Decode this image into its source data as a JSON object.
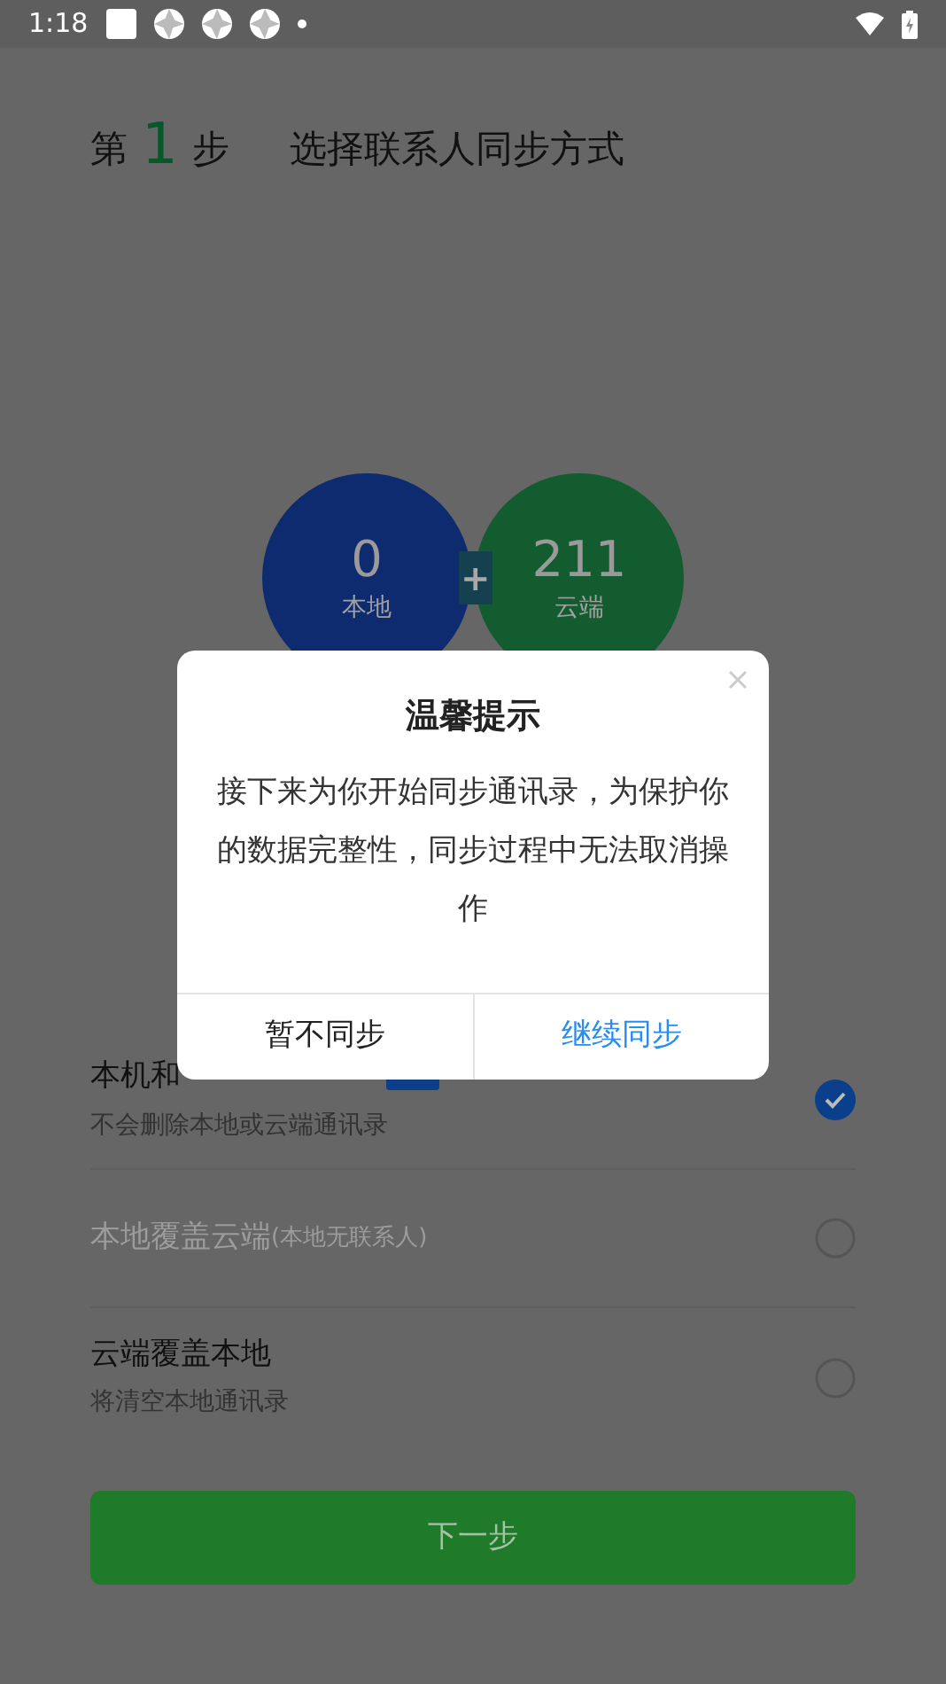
{
  "status_bar": {
    "time": "1:18"
  },
  "header": {
    "step_prefix": "第",
    "step_number": "1",
    "step_suffix": "步",
    "title": "选择联系人同步方式"
  },
  "counts": [
    {
      "value": "0",
      "label": "本地",
      "color": "#0d2b6e"
    },
    {
      "value": "211",
      "label": "云端",
      "color": "#135c30"
    }
  ],
  "plus": "+",
  "options": [
    {
      "title": "本机和",
      "subtitle": "不会删除本地或云端通讯录",
      "badge": true,
      "disabled": false,
      "selected": true
    },
    {
      "title": "本地覆盖云端",
      "note": "(本地无联系人)",
      "badge": false,
      "disabled": true,
      "selected": false
    },
    {
      "title": "云端覆盖本地",
      "subtitle": "将清空本地通讯录",
      "badge": false,
      "disabled": false,
      "selected": false
    }
  ],
  "next_button": {
    "label": "下一步"
  },
  "dialog": {
    "title": "温馨提示",
    "message": "接下来为你开始同步通讯录，为保护你的数据完整性，同步过程中无法取消操作",
    "buttons": [
      {
        "label": "暂不同步",
        "kind": "secondary"
      },
      {
        "label": "继续同步",
        "kind": "primary"
      }
    ]
  }
}
